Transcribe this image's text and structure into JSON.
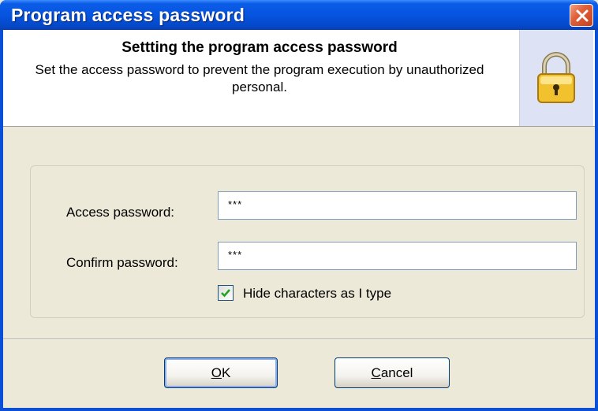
{
  "window": {
    "title": "Program access password"
  },
  "header": {
    "title": "Settting the program access password",
    "description": "Set the access password to prevent the program execution by unauthorized personal."
  },
  "form": {
    "access_label": "Access password:",
    "access_value": "***",
    "confirm_label": "Confirm password:",
    "confirm_value": "***",
    "hide_label": "Hide characters as I type",
    "hide_checked": true
  },
  "buttons": {
    "ok_mnemonic": "O",
    "ok_rest": "K",
    "cancel_mnemonic": "C",
    "cancel_rest": "ancel"
  },
  "colors": {
    "titlebar": "#0654e0",
    "close": "#e0603a",
    "dialog_bg": "#ece9d8",
    "lock": "#f2c12e"
  },
  "icons": {
    "close": "close-icon",
    "lock": "padlock-icon",
    "check": "checkmark-icon"
  }
}
